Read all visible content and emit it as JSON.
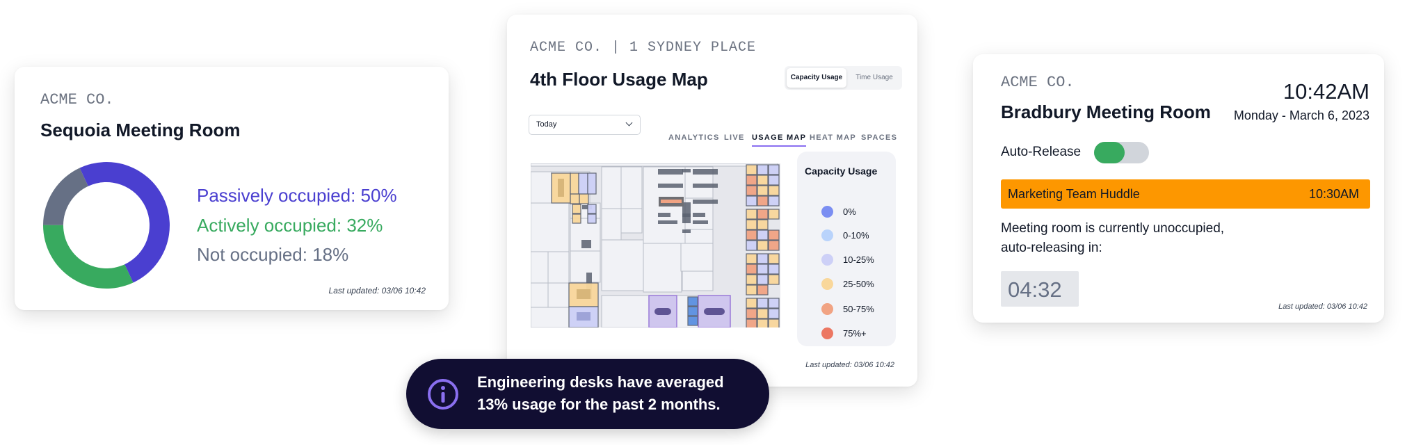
{
  "colors": {
    "passive": "#4a3fd0",
    "active": "#38aa5f",
    "none": "#667085",
    "accent": "#8a6ff0",
    "orange": "#fd9700",
    "toggle_on": "#38aa5f",
    "tooltip_bg": "#110e32"
  },
  "sequoia": {
    "company": "ACME CO.",
    "title": "Sequoia Meeting Room",
    "chart_data": {
      "type": "pie",
      "variant": "donut",
      "categories": [
        "Passively occupied",
        "Actively occupied",
        "Not occupied"
      ],
      "values": [
        50,
        32,
        18
      ],
      "colors": [
        "#4a3fd0",
        "#38aa5f",
        "#667085"
      ]
    },
    "legend": [
      "Passively occupied: 50%",
      "Actively occupied: 32%",
      "Not occupied: 18%"
    ],
    "last_updated": "Last updated: 03/06 10:42"
  },
  "usage_map": {
    "header": "ACME CO. | 1 SYDNEY PLACE",
    "title": "4th Floor Usage Map",
    "toggle": {
      "options": [
        "Capacity Usage",
        "Time Usage"
      ],
      "selected": "Capacity Usage"
    },
    "date_select": {
      "value": "Today"
    },
    "tabs": [
      "ANALYTICS",
      "LIVE",
      "USAGE MAP",
      "HEAT MAP",
      "SPACES"
    ],
    "active_tab": "USAGE MAP",
    "legend": {
      "title": "Capacity Usage",
      "items": [
        {
          "label": "0%",
          "color": "#7b8ef2"
        },
        {
          "label": "0-10%",
          "color": "#b9d3fb"
        },
        {
          "label": "10-25%",
          "color": "#cdd0f7"
        },
        {
          "label": "25-50%",
          "color": "#f9d79b"
        },
        {
          "label": "50-75%",
          "color": "#f1a383"
        },
        {
          "label": "75%+",
          "color": "#ec7762"
        }
      ]
    },
    "last_updated": "Last updated: 03/06 10:42"
  },
  "tooltip": {
    "icon": "info-icon",
    "line1": "Engineering desks have averaged",
    "line2": "13% usage for the past 2 months."
  },
  "bradbury": {
    "company": "ACME CO.",
    "title": "Bradbury Meeting Room",
    "time": "10:42AM",
    "date": "Monday - March 6, 2023",
    "auto_release_label": "Auto-Release",
    "auto_release_on": true,
    "meeting": {
      "name": "Marketing Team Huddle",
      "time": "10:30AM"
    },
    "message_line1": "Meeting room is currently unoccupied,",
    "message_line2": "auto-releasing in:",
    "countdown": "04:32",
    "last_updated": "Last updated: 03/06 10:42"
  }
}
